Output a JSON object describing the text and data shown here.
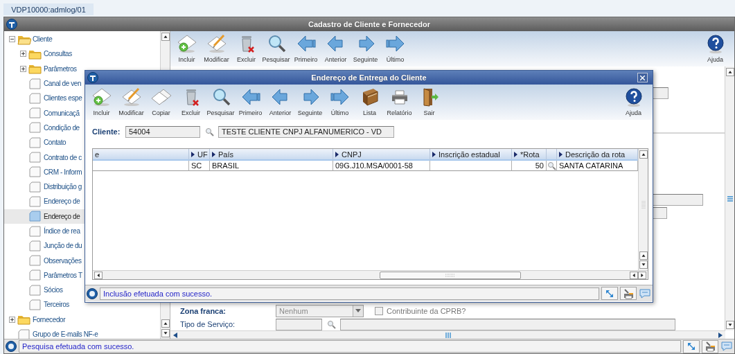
{
  "app_tab": {
    "label": "VDP10000:admlog/01"
  },
  "window": {
    "title": "Cadastro de Cliente e Fornecedor"
  },
  "tree": [
    {
      "label": "Cliente",
      "kind": "folder",
      "expanded": true,
      "selected": false,
      "children": [
        {
          "label": "Consultas",
          "kind": "folder",
          "expanded": false,
          "selected": false
        },
        {
          "label": "Parâmetros",
          "kind": "folder",
          "expanded": false,
          "selected": false
        },
        {
          "label": "Canal de ven",
          "kind": "page",
          "selected": false
        },
        {
          "label": "Clientes espe",
          "kind": "page",
          "selected": false
        },
        {
          "label": "Comunicaçã",
          "kind": "page",
          "selected": false
        },
        {
          "label": "Condição de",
          "kind": "page",
          "selected": false
        },
        {
          "label": "Contato",
          "kind": "page",
          "selected": false
        },
        {
          "label": "Contrato de c",
          "kind": "page",
          "selected": false
        },
        {
          "label": "CRM - Inform",
          "kind": "page",
          "selected": false
        },
        {
          "label": "Distribuição g",
          "kind": "page",
          "selected": false
        },
        {
          "label": "Endereço de",
          "kind": "page",
          "selected": false
        },
        {
          "label": "Endereço de",
          "kind": "page",
          "selected": true
        },
        {
          "label": "Índice de rea",
          "kind": "page",
          "selected": false
        },
        {
          "label": "Junção de du",
          "kind": "page",
          "selected": false
        },
        {
          "label": "Observações",
          "kind": "page",
          "selected": false
        },
        {
          "label": "Parâmetros T",
          "kind": "page",
          "selected": false
        },
        {
          "label": "Sócios",
          "kind": "page",
          "selected": false
        },
        {
          "label": "Terceiros",
          "kind": "page",
          "selected": false
        }
      ]
    },
    {
      "label": "Fornecedor",
      "kind": "folder",
      "expanded": false,
      "selected": false
    },
    {
      "label": "Grupo de E-mails NF-e",
      "kind": "page",
      "selected": false
    }
  ],
  "toolbar": [
    {
      "label": "Incluir",
      "kind": "add"
    },
    {
      "label": "Modificar",
      "kind": "edit"
    },
    {
      "label": "Excluir",
      "kind": "delete"
    },
    {
      "label": "Pesquisar",
      "kind": "search"
    },
    {
      "label": "Primeiro",
      "kind": "first"
    },
    {
      "label": "Anterior",
      "kind": "prev"
    },
    {
      "label": "Seguinte",
      "kind": "next"
    },
    {
      "label": "Último",
      "kind": "last"
    },
    {
      "label": "Ajuda",
      "kind": "help"
    }
  ],
  "form": {
    "zona_franca": {
      "label": "Zona franca:",
      "value": "Nenhum",
      "disabled": true
    },
    "cprb": {
      "label": "Contribuinte da CPRB?",
      "checked": false,
      "disabled": true
    },
    "tipo_servico": {
      "label": "Tipo de Serviço:"
    }
  },
  "status_bar": {
    "message": "Pesquisa efetuada com sucesso."
  },
  "dialog": {
    "title": "Endereço de Entrega do Cliente",
    "toolbar": [
      {
        "label": "Incluir",
        "kind": "add"
      },
      {
        "label": "Modificar",
        "kind": "edit"
      },
      {
        "label": "Copiar",
        "kind": "copy"
      },
      {
        "label": "Excluir",
        "kind": "delete"
      },
      {
        "label": "Pesquisar",
        "kind": "search"
      },
      {
        "label": "Primeiro",
        "kind": "first"
      },
      {
        "label": "Anterior",
        "kind": "prev"
      },
      {
        "label": "Seguinte",
        "kind": "next"
      },
      {
        "label": "Último",
        "kind": "last"
      },
      {
        "label": "Lista",
        "kind": "list"
      },
      {
        "label": "Relatório",
        "kind": "print"
      },
      {
        "label": "Sair",
        "kind": "exit"
      },
      {
        "label": "Ajuda",
        "kind": "help"
      }
    ],
    "cliente": {
      "label": "Cliente:",
      "code": "54004",
      "name": "TESTE CLIENTE CNPJ ALFANUMERICO - VD"
    },
    "table": {
      "columns": [
        {
          "label": "e",
          "kind": "text",
          "arrow": false
        },
        {
          "label": "UF",
          "kind": "text",
          "arrow": true
        },
        {
          "label": "País",
          "kind": "text",
          "arrow": true
        },
        {
          "label": "CNPJ",
          "kind": "text",
          "arrow": true
        },
        {
          "label": "Inscrição estadual",
          "kind": "text",
          "arrow": true
        },
        {
          "label": "*Rota",
          "kind": "number",
          "arrow": true
        },
        {
          "kind": "lookup",
          "arrow": false
        },
        {
          "label": "Descrição da rota",
          "kind": "text",
          "arrow": true
        }
      ],
      "rows": [
        {
          "cells": [
            null,
            "SC",
            "BRASIL",
            "09G.J10.MSA/0001-58",
            null,
            "50",
            null,
            "SANTA CATARINA"
          ]
        }
      ]
    },
    "status_bar": {
      "message": "Inclusão efetuada com sucesso."
    }
  }
}
